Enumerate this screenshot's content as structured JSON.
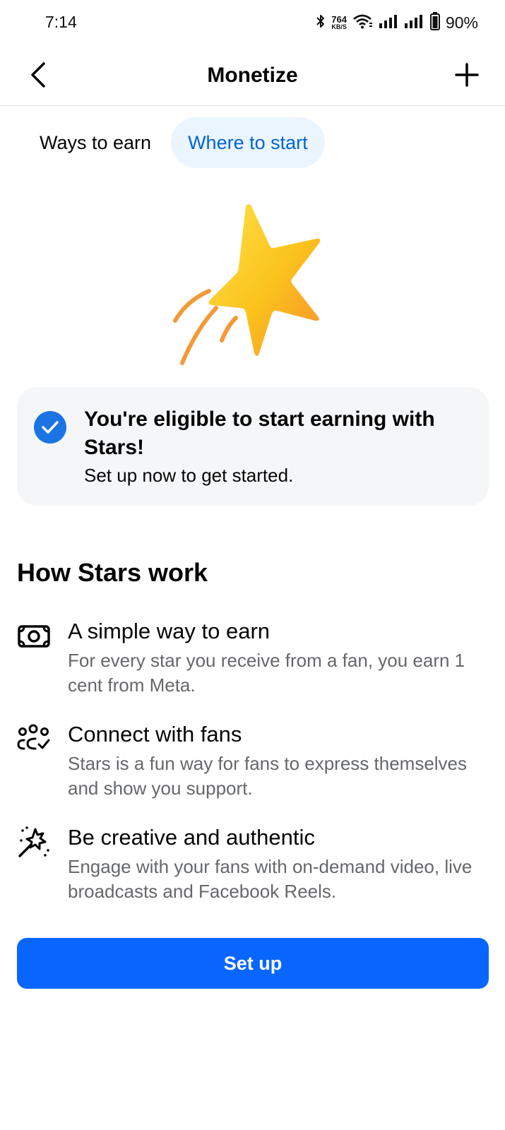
{
  "status_bar": {
    "time": "7:14",
    "net_speed_value": "764",
    "net_speed_unit": "KB/S",
    "battery": "90%",
    "icons": [
      "bluetooth-icon",
      "wifi-icon",
      "signal-icon",
      "signal-icon",
      "battery-icon"
    ]
  },
  "header": {
    "title": "Monetize",
    "back_icon": "chevron-left-icon",
    "add_icon": "plus-icon"
  },
  "tabs": [
    {
      "label": "Ways to earn",
      "active": false
    },
    {
      "label": "Where to start",
      "active": true
    }
  ],
  "hero": {
    "icon": "shooting-star-icon"
  },
  "eligible_card": {
    "title": "You're eligible to start earning with Stars!",
    "subtitle": "Set up now to get started.",
    "icon": "checkmark-circle-icon"
  },
  "how_it_works": {
    "title": "How Stars work",
    "items": [
      {
        "icon": "money-icon",
        "title": "A simple way to earn",
        "description": "For every star you receive from a fan, you earn 1 cent from Meta."
      },
      {
        "icon": "people-check-icon",
        "title": "Connect with fans",
        "description": "Stars is a fun way for fans to express themselves and show you support."
      },
      {
        "icon": "magic-wand-icon",
        "title": "Be creative and authentic",
        "description": "Engage with your fans with on-demand video, live broadcasts and Facebook Reels."
      }
    ]
  },
  "setup_button": {
    "label": "Set up"
  },
  "colors": {
    "accent": "#0866ff",
    "tab_active_bg": "#ebf5ff",
    "tab_active_text": "#0064d1",
    "card_bg": "#f5f6f8",
    "secondary_text": "#65676b",
    "star_yellow": "#fcd116",
    "star_orange": "#f79b2e"
  }
}
